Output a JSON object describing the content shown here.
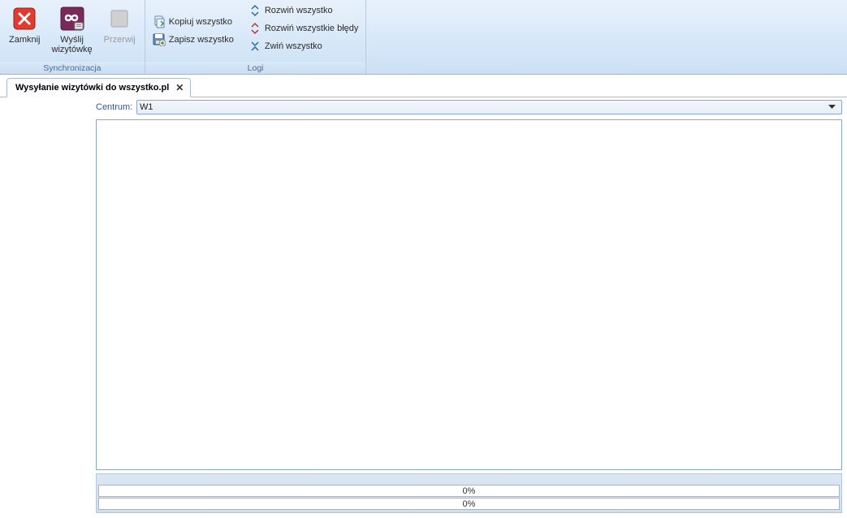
{
  "ribbon": {
    "close": "Zamknij",
    "send": "Wyślij\nwizytówkę",
    "cancel": "Przerwij",
    "group_sync": "Synchronizacja",
    "copy_all": "Kopiuj wszystko",
    "save_all": "Zapisz wszystko",
    "expand_all": "Rozwiń wszystko",
    "expand_errors": "Rozwiń wszystkie błędy",
    "collapse_all": "Zwiń wszystko",
    "group_logs": "Logi"
  },
  "tab": {
    "title": "Wysyłanie wizytówki do wszystko.pl"
  },
  "panel": {
    "centrum_label": "Centrum:",
    "centrum_value": "W1"
  },
  "progress": {
    "bar1": "0%",
    "bar2": "0%"
  }
}
